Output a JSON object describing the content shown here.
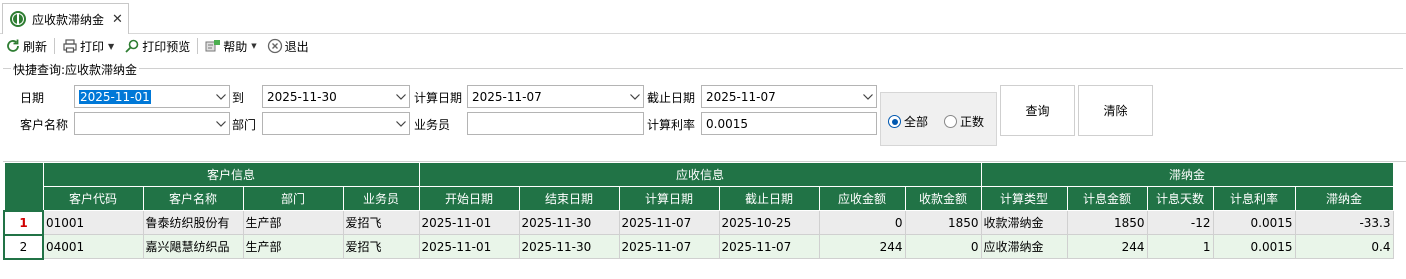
{
  "tab": {
    "label": "应收款滞纳金",
    "close": "✕"
  },
  "toolbar": {
    "refresh": "刷新",
    "print": "打印",
    "print_preview": "打印预览",
    "help": "帮助",
    "exit": "退出"
  },
  "query": {
    "group_title": "快捷查询:应收款滞纳金",
    "date_label": "日期",
    "date_from": "2025-11-01",
    "to_label": "到",
    "date_to": "2025-11-30",
    "calc_date_label": "计算日期",
    "calc_date": "2025-11-07",
    "cutoff_label": "截止日期",
    "cutoff_date": "2025-11-07",
    "customer_label": "客户名称",
    "customer_value": "",
    "dept_label": "部门",
    "dept_value": "",
    "salesman_label": "业务员",
    "salesman_value": "",
    "rate_label": "计算利率",
    "rate_value": "0.0015",
    "radio_all": "全部",
    "radio_positive": "正数",
    "query_button": "查询",
    "clear_button": "清除"
  },
  "grid": {
    "groups": [
      {
        "label": "客户信息"
      },
      {
        "label": "应收信息"
      },
      {
        "label": "滞纳金"
      }
    ],
    "columns": [
      "客户代码",
      "客户名称",
      "部门",
      "业务员",
      "开始日期",
      "结束日期",
      "计算日期",
      "截止日期",
      "应收金额",
      "收款金额",
      "计算类型",
      "计息金额",
      "计息天数",
      "计息利率",
      "滞纳金"
    ],
    "rows": [
      {
        "no": "1",
        "cells": [
          "01001",
          "鲁泰纺织股份有",
          "生产部",
          "爱招飞",
          "2025-11-01",
          "2025-11-30",
          "2025-11-07",
          "2025-10-25",
          "0",
          "1850",
          "收款滞纳金",
          "1850",
          "-12",
          "0.0015",
          "-33.3"
        ]
      },
      {
        "no": "2",
        "cells": [
          "04001",
          "嘉兴飓慧纺织品",
          "生产部",
          "爱招飞",
          "2025-11-01",
          "2025-11-30",
          "2025-11-07",
          "2025-11-07",
          "244",
          "0",
          "应收滞纳金",
          "244",
          "1",
          "0.0015",
          "0.4"
        ]
      }
    ]
  },
  "colors": {
    "header_green": "#217346",
    "row_alt": "#e9f5e9",
    "row_selected": "#ececec",
    "selection_blue": "#0078d7"
  }
}
